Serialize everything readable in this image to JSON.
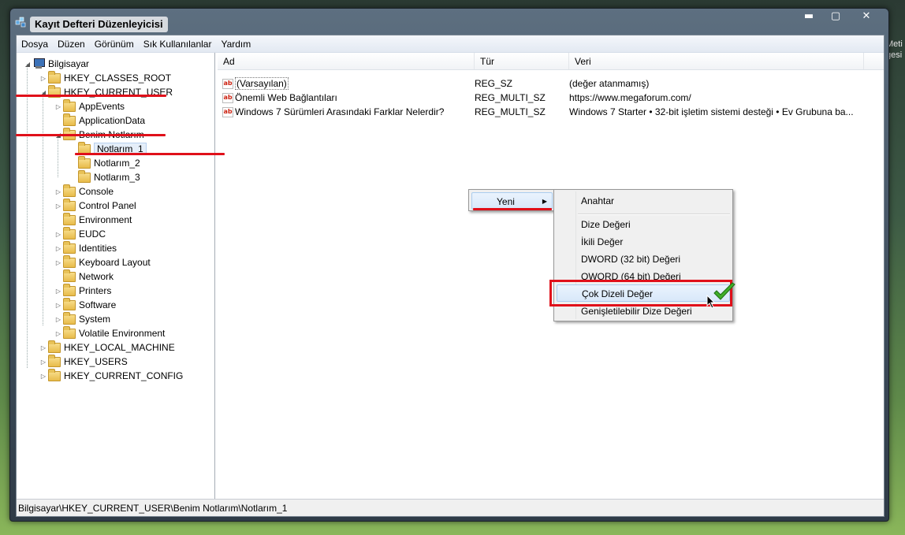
{
  "desktop": {
    "text_1": "Meti",
    "text_2": "gesi"
  },
  "window": {
    "title": "Kayıt Defteri Düzenleyicisi",
    "buttons": {
      "minimize": "▬",
      "maximize": "▢",
      "close": "✕"
    }
  },
  "menubar": [
    "Dosya",
    "Düzen",
    "Görünüm",
    "Sık Kullanılanlar",
    "Yardım"
  ],
  "tree": {
    "root": "Bilgisayar",
    "hives": [
      "HKEY_CLASSES_ROOT",
      "HKEY_CURRENT_USER",
      "HKEY_LOCAL_MACHINE",
      "HKEY_USERS",
      "HKEY_CURRENT_CONFIG"
    ],
    "current_user_children": [
      "AppEvents",
      "ApplicationData",
      "Benim Notlarım",
      "Console",
      "Control Panel",
      "Environment",
      "EUDC",
      "Identities",
      "Keyboard Layout",
      "Network",
      "Printers",
      "Software",
      "System",
      "Volatile Environment"
    ],
    "notes_children": [
      "Notlarım_1",
      "Notlarım_2",
      "Notlarım_3"
    ]
  },
  "columns": {
    "name": "Ad",
    "type": "Tür",
    "data": "Veri"
  },
  "values": [
    {
      "name": "(Varsayılan)",
      "type": "REG_SZ",
      "data": "(değer atanmamış)"
    },
    {
      "name": "Önemli Web Bağlantıları",
      "type": "REG_MULTI_SZ",
      "data": "https://www.megaforum.com/"
    },
    {
      "name": "Windows 7 Sürümleri Arasındaki Farklar Nelerdir?",
      "type": "REG_MULTI_SZ",
      "data": "Windows 7 Starter • 32-bit işletim sistemi desteği • Ev Grubuna ba..."
    }
  ],
  "value_icon": "ab",
  "status": "Bilgisayar\\HKEY_CURRENT_USER\\Benim Notlarım\\Notlarım_1",
  "context_menu": {
    "parent": "Yeni",
    "items": [
      "Anahtar",
      "Dize Değeri",
      "İkili Değer",
      "DWORD (32 bit) Değeri",
      "QWORD (64 bit) Değeri",
      "Çok Dizeli Değer",
      "Genişletilebilir Dize Değeri"
    ]
  },
  "colors": {
    "highlight_red": "#e0101a",
    "check_green": "#3fae2a"
  }
}
